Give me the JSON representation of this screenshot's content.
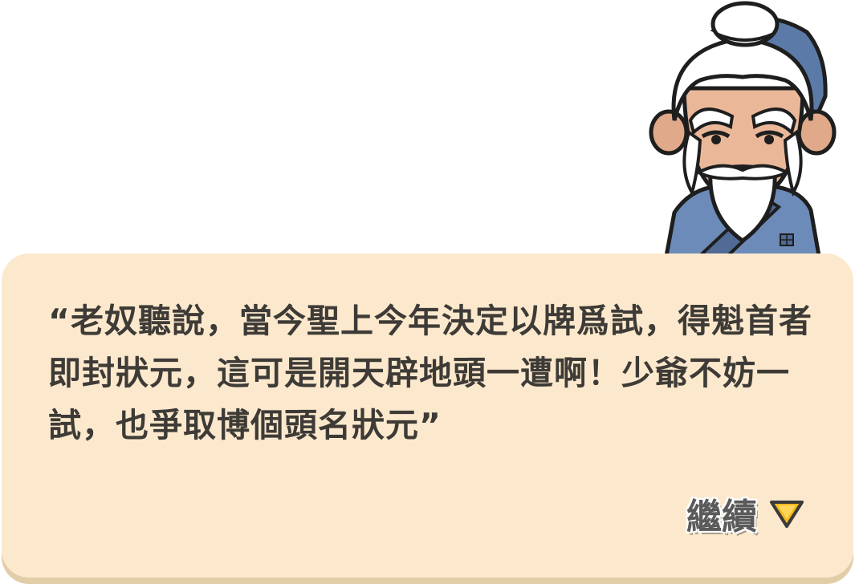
{
  "dialog": {
    "text": "“老奴聽說，當今聖上今年決定以牌爲試，得魁首者即封狀元，這可是開天辟地頭一遭啊！少爺不妨一試，也爭取博個頭名狀元”",
    "continue_label": "繼續"
  },
  "colors": {
    "box_bg": "#fce9cd",
    "text": "#3e3b37",
    "arrow": "#f5b91c"
  },
  "icons": {
    "continue": "triangle-down-icon",
    "speaker": "old-servant-portrait"
  }
}
